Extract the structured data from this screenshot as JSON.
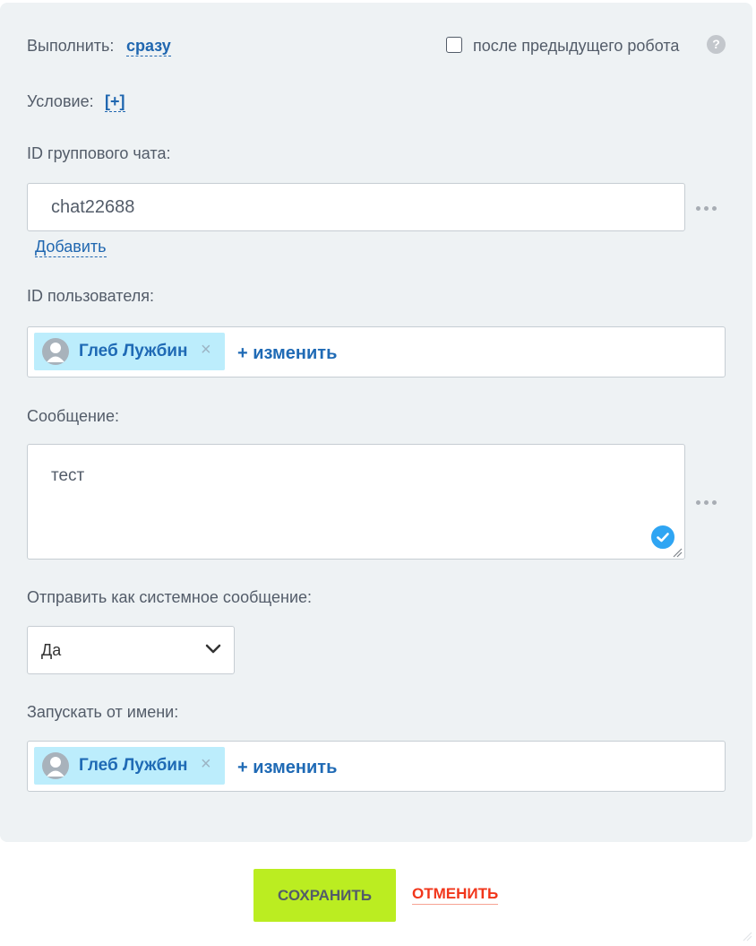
{
  "execute": {
    "label": "Выполнить:",
    "value": "сразу",
    "after_previous_label": "после предыдущего робота",
    "after_previous_checked": false,
    "help_icon": "?"
  },
  "condition": {
    "label": "Условие:",
    "add_link": "[+]"
  },
  "group_chat": {
    "label": "ID группового чата:",
    "value": "chat22688",
    "add_link": "Добавить"
  },
  "user_id": {
    "label": "ID пользователя:",
    "tag_name": "Глеб Лужбин",
    "remove_icon": "×",
    "change_link": "+ изменить"
  },
  "message": {
    "label": "Сообщение:",
    "value": "тест"
  },
  "system_message": {
    "label": "Отправить как системное сообщение:",
    "selected": "Да"
  },
  "run_as": {
    "label": "Запускать от имени:",
    "tag_name": "Глеб Лужбин",
    "remove_icon": "×",
    "change_link": "+ изменить"
  },
  "buttons": {
    "save": "СОХРАНИТЬ",
    "cancel": "ОТМЕНИТЬ"
  },
  "colors": {
    "link": "#2067b0",
    "save_bg": "#bbed21",
    "cancel": "#f1361b",
    "tag_bg": "#bcedfc",
    "panel_bg": "#eef2f4"
  }
}
